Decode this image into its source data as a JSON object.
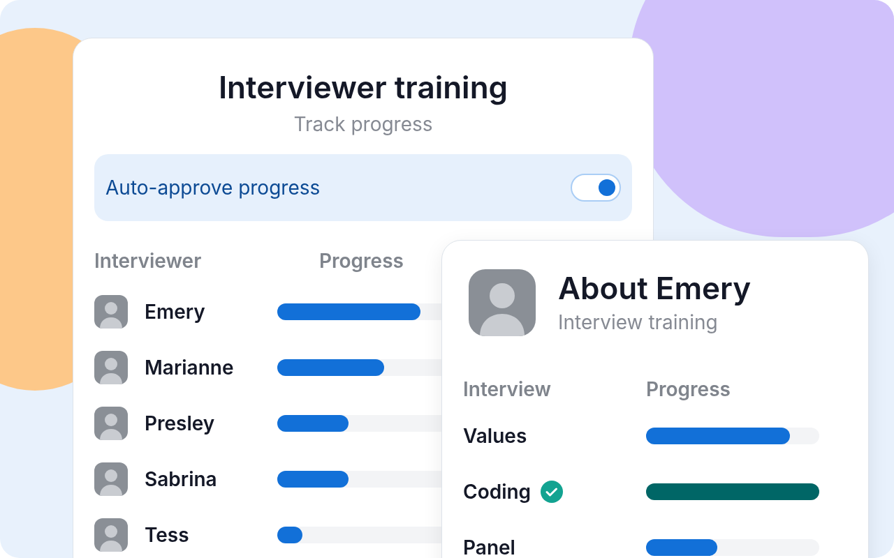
{
  "training_card": {
    "title": "Interviewer training",
    "subtitle": "Track progress",
    "auto_approve": {
      "label": "Auto-approve progress",
      "on": true
    },
    "columns": [
      "Interviewer",
      "Progress"
    ],
    "rows": [
      {
        "name": "Emery",
        "level": 0.873
      },
      {
        "name": "Marianne",
        "level": 0.653
      },
      {
        "name": "Presley",
        "level": 0.432
      },
      {
        "name": "Sabrina",
        "level": 0.432
      },
      {
        "name": "Tess",
        "level": 0.153
      }
    ]
  },
  "detail_card": {
    "title": "About Emery",
    "subtitle": "Interview training",
    "columns": [
      "Interview",
      "Progress"
    ],
    "rows": [
      {
        "name": "Values",
        "completed": false,
        "level": 0.83
      },
      {
        "name": "Coding",
        "completed": true,
        "level": 1
      },
      {
        "name": "Panel",
        "completed": false,
        "level": 0.41
      }
    ]
  }
}
